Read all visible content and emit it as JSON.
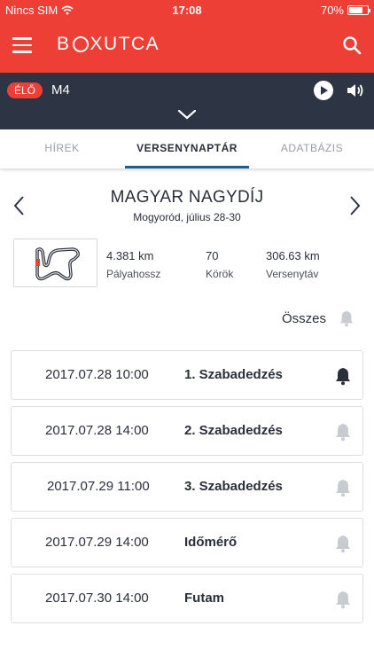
{
  "status_bar": {
    "carrier": "Nincs SIM",
    "time": "17:08",
    "battery": "70%"
  },
  "app": {
    "logo_left": "B",
    "logo_right": "XUTCA"
  },
  "live": {
    "badge": "ÉLŐ",
    "channel": "M4"
  },
  "tabs": [
    {
      "label": "HÍREK",
      "active": false
    },
    {
      "label": "VERSENYNAPTÁR",
      "active": true
    },
    {
      "label": "ADATBÁZIS",
      "active": false
    }
  ],
  "race": {
    "title": "MAGYAR NAGYDÍJ",
    "subtitle": "Mogyoród, július 28-30"
  },
  "stats": [
    {
      "value": "4.381 km",
      "label": "Pályahossz"
    },
    {
      "value": "70",
      "label": "Körök"
    },
    {
      "value": "306.63 km",
      "label": "Versenytáv"
    }
  ],
  "all_label": "Összes",
  "sessions": [
    {
      "datetime": "2017.07.28 10:00",
      "name": "1. Szabadedzés",
      "notify": true
    },
    {
      "datetime": "2017.07.28 14:00",
      "name": "2. Szabadedzés",
      "notify": false
    },
    {
      "datetime": "2017.07.29 11:00",
      "name": "3. Szabadedzés",
      "notify": false
    },
    {
      "datetime": "2017.07.29 14:00",
      "name": "Időmérő",
      "notify": false
    },
    {
      "datetime": "2017.07.30 14:00",
      "name": "Futam",
      "notify": false
    }
  ],
  "colors": {
    "brand_red": "#ee3f36",
    "live_bar": "#2d3444",
    "tab_indicator": "#1e5f8f",
    "bell_active": "#2b2f3a",
    "bell_inactive": "#c8cbd0"
  },
  "icons": {
    "menu": "hamburger-icon",
    "search": "search-icon",
    "play": "play-icon",
    "volume": "volume-icon",
    "expand": "chevron-down-icon",
    "prev": "chevron-left-icon",
    "next": "chevron-right-icon",
    "notify": "bell-icon",
    "track": "track-map-icon"
  }
}
